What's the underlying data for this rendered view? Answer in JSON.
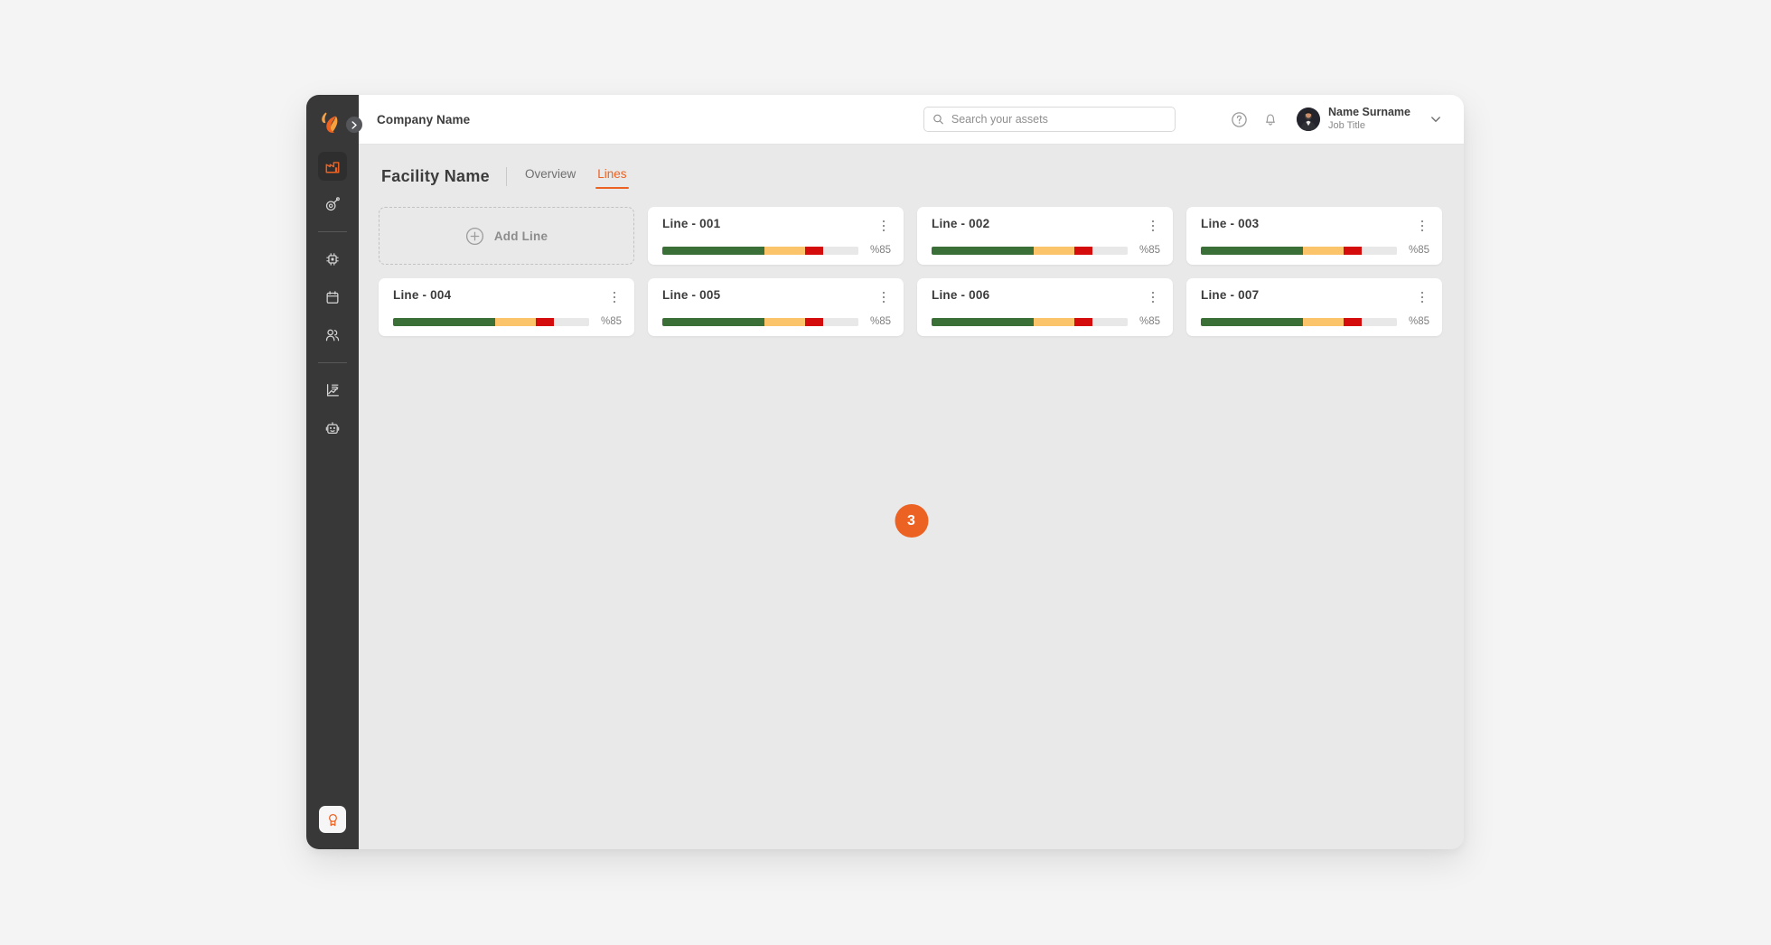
{
  "theme": {
    "accent": "#ec6223",
    "sidebar_bg": "#383838",
    "canvas_bg": "#e9e9e9",
    "card_bg": "#ffffff",
    "bar_green": "#3a7038",
    "bar_yellow": "#fbc46a",
    "bar_red": "#d50c0c",
    "bar_gray": "#e8e8e8"
  },
  "sidebar": {
    "logo_name": "flame-logo",
    "collapse_toggle_label": "collapse-sidebar",
    "items": [
      {
        "name": "factory",
        "icon": "factory-icon",
        "active": true
      },
      {
        "name": "assets",
        "icon": "gauge-icon",
        "active": false
      },
      {
        "name": "machines",
        "icon": "chip-icon",
        "active": false
      },
      {
        "name": "calendar",
        "icon": "calendar-icon",
        "active": false
      },
      {
        "name": "teams",
        "icon": "users-icon",
        "active": false
      },
      {
        "name": "reports",
        "icon": "report-chart-icon",
        "active": false
      },
      {
        "name": "automation",
        "icon": "robot-icon",
        "active": false
      }
    ],
    "footer_item": {
      "name": "achievements",
      "icon": "award-icon"
    }
  },
  "topbar": {
    "company_name": "Company Name",
    "search": {
      "placeholder": "Search your assets",
      "value": "",
      "icon": "search-icon"
    },
    "help_icon": "help-circle-icon",
    "notification_icon": "bell-icon",
    "user": {
      "name": "Name Surname",
      "job_title": "Job Title",
      "avatar": "avatar",
      "chevron": "chevron-down-icon"
    }
  },
  "page": {
    "facility_title": "Facility  Name",
    "tabs": [
      {
        "label": "Overview",
        "active": false
      },
      {
        "label": "Lines",
        "active": true
      }
    ],
    "add_card": {
      "label": "Add Line",
      "icon": "plus-circle-icon"
    },
    "step_badge": "3"
  },
  "lines": [
    {
      "title": "Line - 001",
      "percent": "%85",
      "segments": [
        52,
        21,
        9,
        18
      ]
    },
    {
      "title": "Line - 002",
      "percent": "%85",
      "segments": [
        52,
        21,
        9,
        18
      ]
    },
    {
      "title": "Line - 003",
      "percent": "%85",
      "segments": [
        52,
        21,
        9,
        18
      ]
    },
    {
      "title": "Line - 004",
      "percent": "%85",
      "segments": [
        52,
        21,
        9,
        18
      ]
    },
    {
      "title": "Line - 005",
      "percent": "%85",
      "segments": [
        52,
        21,
        9,
        18
      ]
    },
    {
      "title": "Line - 006",
      "percent": "%85",
      "segments": [
        52,
        21,
        9,
        18
      ]
    },
    {
      "title": "Line - 007",
      "percent": "%85",
      "segments": [
        52,
        21,
        9,
        18
      ]
    }
  ]
}
